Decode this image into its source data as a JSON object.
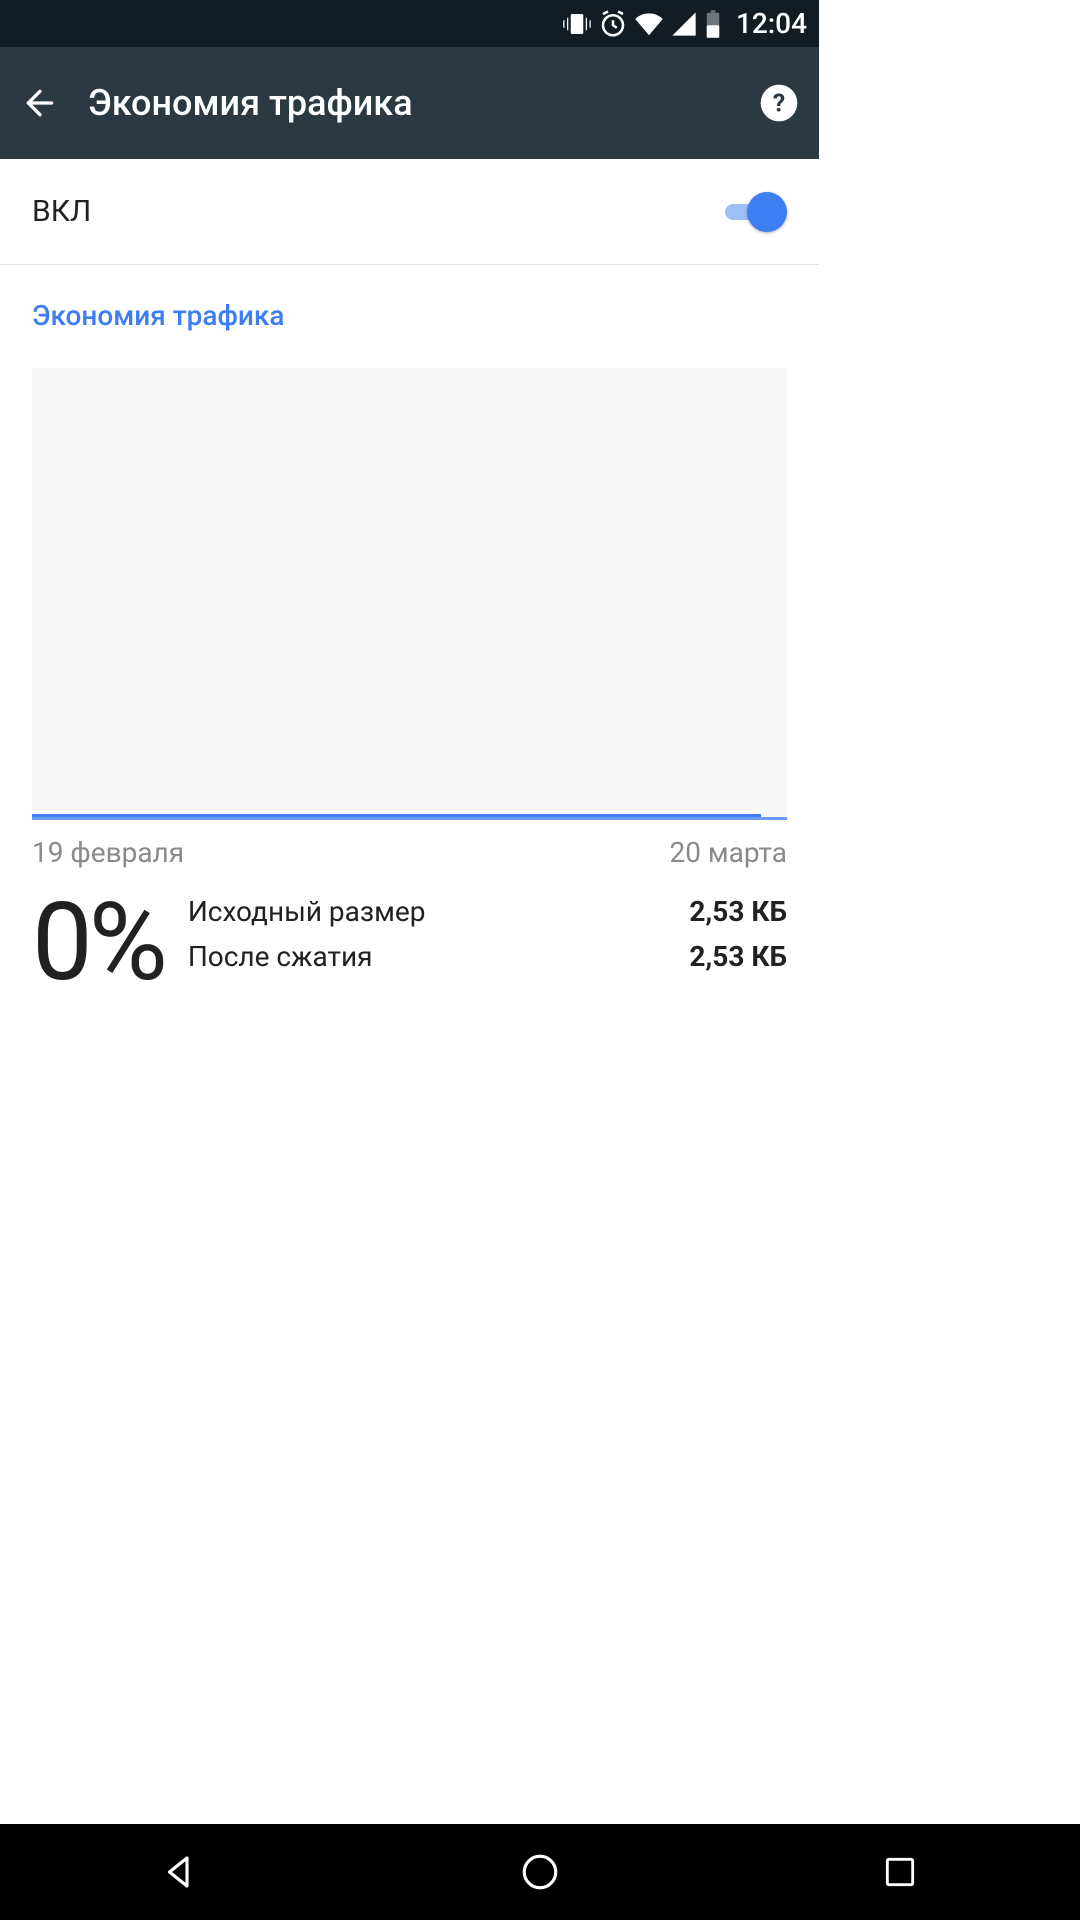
{
  "status": {
    "clock": "12:04"
  },
  "app_bar": {
    "title": "Экономия трафика"
  },
  "toggle": {
    "label": "ВКЛ",
    "on": true
  },
  "section": {
    "title": "Экономия трафика"
  },
  "chart_data": {
    "type": "area",
    "title": "",
    "x": [
      "19 февраля",
      "20 марта"
    ],
    "series": [
      {
        "name": "savings",
        "values": [
          0,
          0
        ]
      }
    ],
    "ylim": [
      0,
      100
    ],
    "xlabel": "",
    "ylabel": ""
  },
  "dates": {
    "start": "19 февраля",
    "end": "20 марта"
  },
  "stats": {
    "percent": "0%",
    "original_label": "Исходный размер",
    "original_value": "2,53 КБ",
    "compressed_label": "После сжатия",
    "compressed_value": "2,53 КБ"
  }
}
